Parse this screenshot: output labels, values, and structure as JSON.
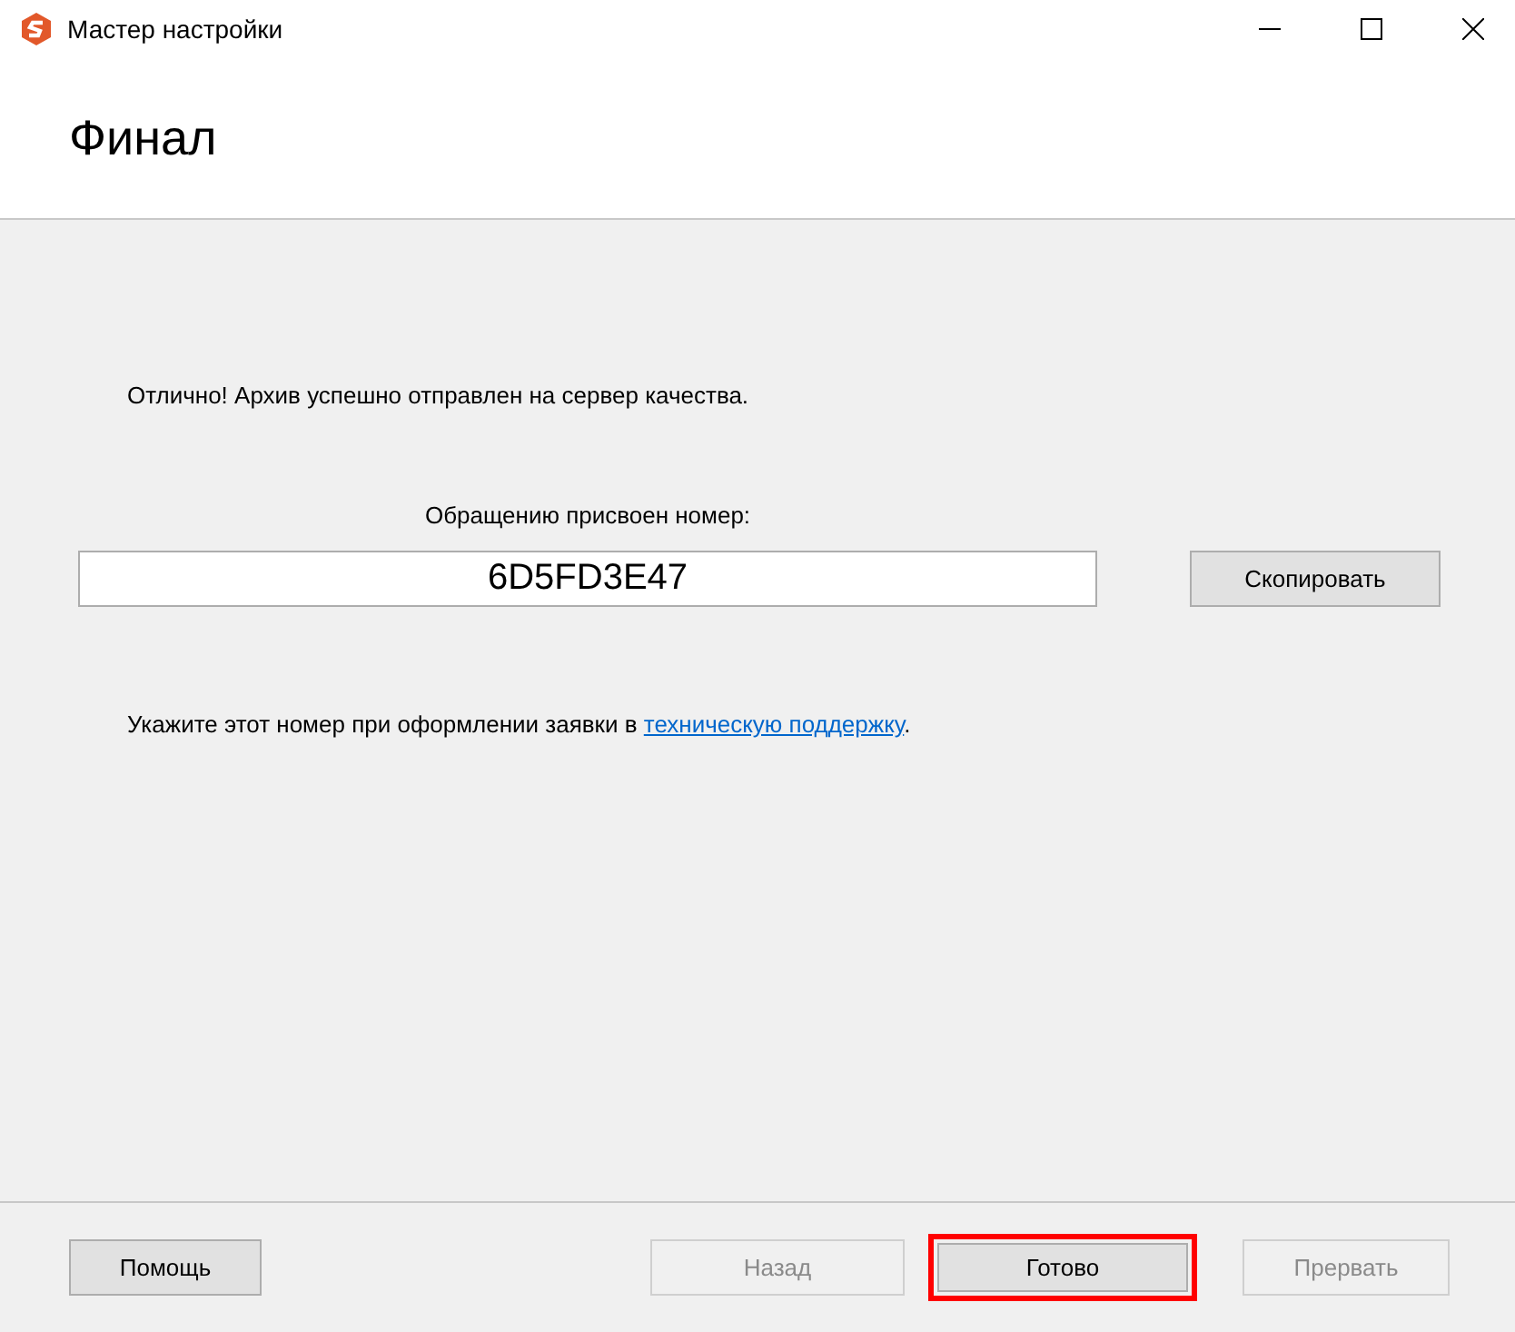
{
  "window": {
    "title": "Мастер настройки"
  },
  "header": {
    "title": "Финал"
  },
  "message": "Отлично! Архив успешно отправлен на сервер качества.",
  "ticket": {
    "label": "Обращению присвоен номер:",
    "value": "6D5FD3E47",
    "copy_button": "Скопировать"
  },
  "support_note": {
    "text_before": "Укажите этот номер при оформлении заявки в ",
    "link": "техническую поддержку",
    "text_after": "."
  },
  "buttons": [
    {
      "label": "Помощь",
      "disabled": false,
      "highlighted": false
    },
    {
      "label": "Назад",
      "disabled": true,
      "highlighted": false
    },
    {
      "label": "Готово",
      "disabled": false,
      "highlighted": true
    },
    {
      "label": "Прервать",
      "disabled": true,
      "highlighted": false
    }
  ]
}
